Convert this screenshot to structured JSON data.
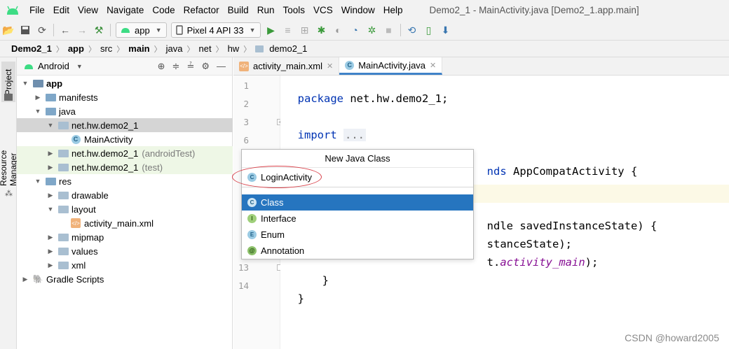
{
  "menubar": {
    "items": [
      "File",
      "Edit",
      "View",
      "Navigate",
      "Code",
      "Refactor",
      "Build",
      "Run",
      "Tools",
      "VCS",
      "Window",
      "Help"
    ],
    "window_title": "Demo2_1 - MainActivity.java [Demo2_1.app.main]"
  },
  "toolbar": {
    "run_config": "app",
    "device": "Pixel 4 API 33"
  },
  "breadcrumb": [
    "Demo2_1",
    "app",
    "src",
    "main",
    "java",
    "net",
    "hw",
    "demo2_1"
  ],
  "left_strip": {
    "project_tab": "Project",
    "resource_manager_tab": "Resource Manager"
  },
  "project_panel": {
    "view_selector": "Android",
    "tree": [
      {
        "label": "app",
        "suffix": ""
      },
      {
        "label": "manifests",
        "suffix": ""
      },
      {
        "label": "java",
        "suffix": ""
      },
      {
        "label": "net.hw.demo2_1",
        "suffix": ""
      },
      {
        "label": "MainActivity",
        "suffix": ""
      },
      {
        "label": "net.hw.demo2_1",
        "suffix": "(androidTest)"
      },
      {
        "label": "net.hw.demo2_1",
        "suffix": "(test)"
      },
      {
        "label": "res",
        "suffix": ""
      },
      {
        "label": "drawable",
        "suffix": ""
      },
      {
        "label": "layout",
        "suffix": ""
      },
      {
        "label": "activity_main.xml",
        "suffix": ""
      },
      {
        "label": "mipmap",
        "suffix": ""
      },
      {
        "label": "values",
        "suffix": ""
      },
      {
        "label": "xml",
        "suffix": ""
      },
      {
        "label": "Gradle Scripts",
        "suffix": ""
      }
    ]
  },
  "editor": {
    "tabs": [
      "activity_main.xml",
      "MainActivity.java"
    ],
    "line_numbers": [
      "1",
      "2",
      "3",
      "6",
      "",
      "",
      "",
      "",
      "",
      "",
      "",
      "13",
      "14"
    ],
    "code": {
      "line1_kw": "package",
      "line1_rest": " net.hw.demo2_1;",
      "line3_kw": "import",
      "line3_fold": "...",
      "line7_kw": "nds",
      "line7_rest": " AppCompatActivity {",
      "line10_rest": "ndle savedInstanceState) {",
      "line11_rest": "stanceState);",
      "line12_pre": "t.",
      "line12_it": "activity_main",
      "line12_post": ");",
      "line13": "}",
      "line14": "}"
    }
  },
  "popup": {
    "title": "New Java Class",
    "input_value": "LoginActivity",
    "items": [
      "Class",
      "Interface",
      "Enum",
      "Annotation"
    ],
    "selected": "Class"
  },
  "watermark": "CSDN @howard2005",
  "colors": {
    "selection": "#2675bf",
    "annotation_oval": "#d9414a",
    "active_tab_underline": "#4083c9"
  }
}
